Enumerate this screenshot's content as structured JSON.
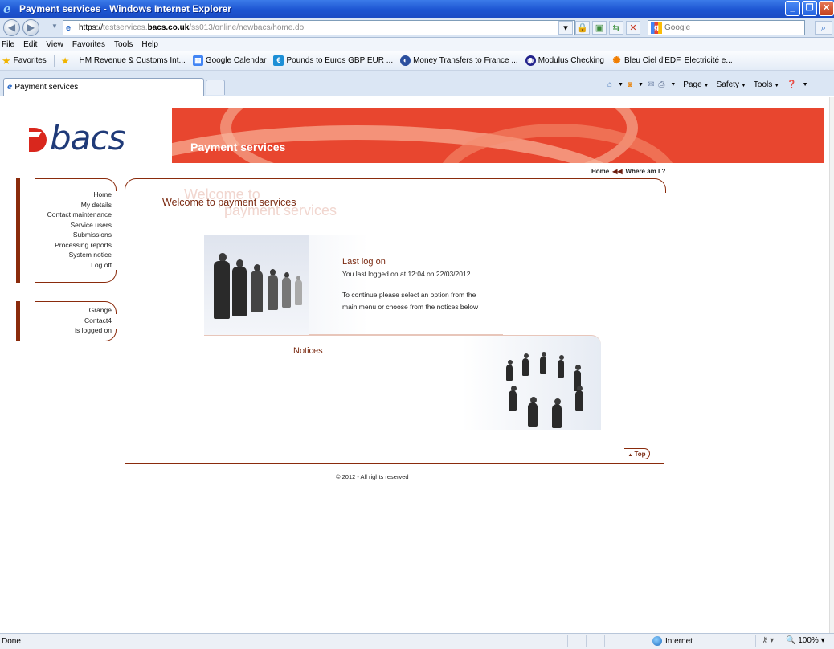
{
  "window": {
    "title": "Payment services - Windows Internet Explorer",
    "minimize": "_",
    "maximize": "❐",
    "close": "✕"
  },
  "address": {
    "url_scheme": "https://",
    "url_host_pre": "testservices.",
    "url_host_main": "bacs.co.uk",
    "url_path": "/ss013/online/newbacs/home.do",
    "search_placeholder": "Google"
  },
  "menu": [
    "File",
    "Edit",
    "View",
    "Favorites",
    "Tools",
    "Help"
  ],
  "favorites": {
    "label": "Favorites",
    "items": [
      {
        "label": "HM Revenue & Customs Int...",
        "icon": "hmrc-icon",
        "color": "#ffffff"
      },
      {
        "label": "Google Calendar",
        "icon": "google-calendar-icon",
        "color": "#4285f4"
      },
      {
        "label": "Pounds to Euros  GBP EUR ...",
        "icon": "currency-icon",
        "color": "#1d8fd6"
      },
      {
        "label": "Money Transfers to France ...",
        "icon": "money-transfer-icon",
        "color": "#2b4f9e"
      },
      {
        "label": "Modulus Checking",
        "icon": "modulus-icon",
        "color": "#23238c"
      },
      {
        "label": "Bleu Ciel d'EDF. Electricité e...",
        "icon": "edf-icon",
        "color": "#f07d00"
      }
    ]
  },
  "tab": {
    "label": "Payment services"
  },
  "commandbar": {
    "page": "Page",
    "safety": "Safety",
    "tools": "Tools"
  },
  "site": {
    "logo_text": "bacs",
    "banner_title": "Payment services",
    "breadcrumb_home": "Home",
    "breadcrumb_where": "Where am I ?",
    "nav_links": [
      "Home",
      "My details",
      "Contact maintenance",
      "Service users",
      "Submissions",
      "Processing reports",
      "System notice",
      "Log off"
    ],
    "user_lines": [
      "Grange",
      "Contact4",
      "is logged on"
    ],
    "welcome_bg_1": "Welcome to",
    "welcome_bg_2": "payment services",
    "welcome": "Welcome to payment services",
    "last_log_heading": "Last log on",
    "last_log_text": "You last logged on at 12:04 on 22/03/2012",
    "continue_1": "To continue please select an option from the",
    "continue_2": "main menu or choose from the notices below",
    "notices": "Notices",
    "top_label": "Top",
    "copyright": "© 2012 - All rights reserved"
  },
  "status": {
    "text": "Done",
    "zone": "Internet",
    "zoom": "100%"
  }
}
